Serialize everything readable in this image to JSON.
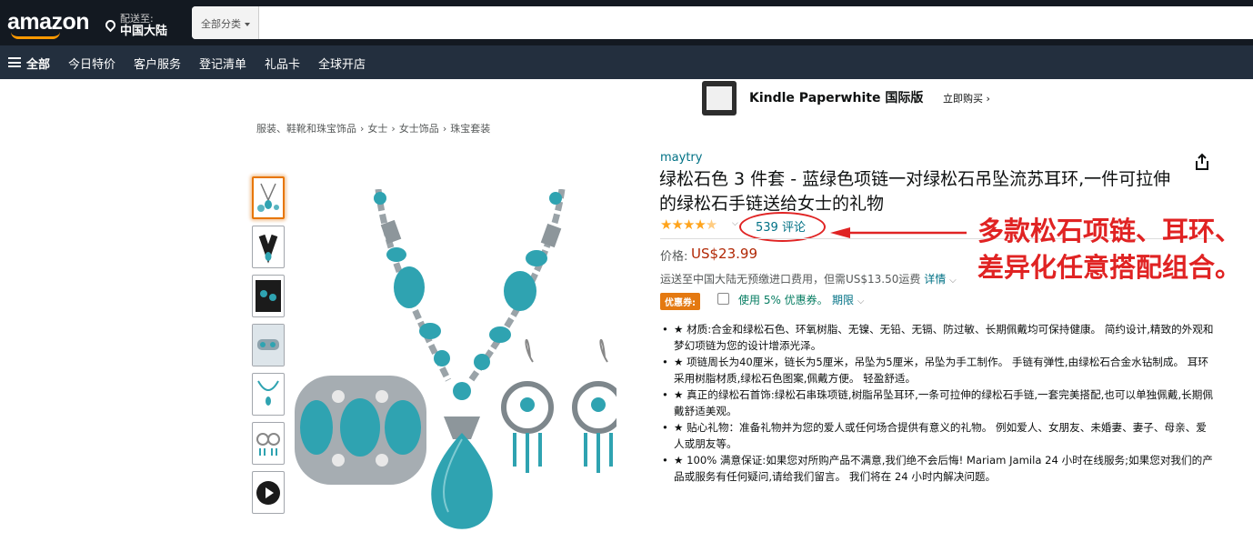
{
  "header": {
    "logo": "amazon",
    "deliver_to_label": "配送至:",
    "deliver_to_location": "中国大陆",
    "search_category": "全部分类",
    "search_value": ""
  },
  "subnav": {
    "all": "全部",
    "items": [
      "今日特价",
      "客户服务",
      "登记清单",
      "礼品卡",
      "全球开店"
    ]
  },
  "banner": {
    "product": "Kindle Paperwhite 国际版",
    "cta": "立即购买 ›"
  },
  "breadcrumb": [
    "服装、鞋靴和珠宝饰品",
    "女士",
    "女士饰品",
    "珠宝套装"
  ],
  "product": {
    "brand": "maytry",
    "title": "绿松石色 3 件套 - 蓝绿色项链一对绿松石吊坠流苏耳环,一件可拉伸的绿松石手链送给女士的礼物",
    "rating": 4.5,
    "reviews": "539 评论",
    "price_label": "价格:",
    "price": "US$23.99",
    "shipping_text": "运送至中国大陆无预缴进口费用，但需US$13.50运费",
    "shipping_link": "详情",
    "coupon_badge": "优惠券:",
    "coupon_text": "使用 5% 优惠券。",
    "coupon_terms": "期限",
    "bullets": [
      "★ 材质:合金和绿松石色、环氧树脂、无镍、无铅、无镉、防过敏、长期佩戴均可保持健康。 简约设计,精致的外观和梦幻项链为您的设计增添光泽。",
      "★ 项链周长为40厘米，链长为5厘米，吊坠为5厘米，吊坠为手工制作。 手链有弹性,由绿松石合金水钻制成。 耳环采用树脂材质,绿松石色图案,佩戴方便。 轻盈舒适。",
      "★ 真正的绿松石首饰:绿松石串珠项链,树脂吊坠耳环,一条可拉伸的绿松石手链,一套完美搭配,也可以单独佩戴,长期佩戴舒适美观。",
      "★ 贴心礼物：准备礼物并为您的爱人或任何场合提供有意义的礼物。 例如爱人、女朋友、未婚妻、妻子、母亲、爱人或朋友等。",
      "★ 100% 满意保证:如果您对所购产品不满意,我们绝不会后悔! Mariam Jamila 24 小时在线服务;如果您对我们的产品或服务有任何疑问,请给我们留言。 我们将在 24 小时内解决问题。"
    ]
  },
  "annotation": {
    "line1": "多款松石项链、耳环、",
    "line2": "差异化任意搭配组合。"
  },
  "colors": {
    "nav_top": "#131921",
    "nav_sub": "#232f3e",
    "accent": "#ff9900",
    "turquoise": "#2fa3b1",
    "price": "#b12704",
    "annotation": "#e02323"
  }
}
